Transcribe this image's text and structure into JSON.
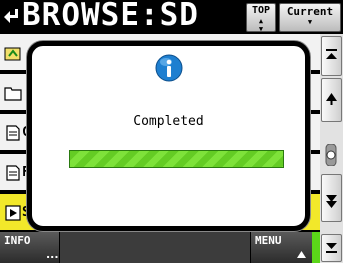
{
  "header": {
    "title": "BROWSE:SD",
    "top_button_label": "TOP",
    "current_button_label": "Current",
    "back_icon": "back-arrow-icon"
  },
  "file_list": {
    "rows": [
      {
        "label": "",
        "icon": "folder-up-icon",
        "selected": false
      },
      {
        "label": "",
        "icon": "folder-icon",
        "selected": false
      },
      {
        "label": "C",
        "icon": "document-icon",
        "selected": false
      },
      {
        "label": "F",
        "icon": "document-icon",
        "selected": false
      },
      {
        "label": "S",
        "icon": "playlist-icon",
        "selected": true
      }
    ]
  },
  "scroll": {
    "icons": [
      "scroll-top-icon",
      "scroll-up-icon",
      "scroll-knob-icon",
      "scroll-down-icon",
      "scroll-bottom-icon"
    ]
  },
  "bottom_bar": {
    "info_label": "INFO",
    "info_dots": "...",
    "menu_label": "MENU"
  },
  "dialog": {
    "icon": "info-icon",
    "message": "Completed",
    "progress": 1.0
  },
  "colors": {
    "selected_row": "#f2e82a",
    "progress_green": "#64cc24",
    "info_blue": "#1e7fd0",
    "accent_green": "#5bd619"
  }
}
